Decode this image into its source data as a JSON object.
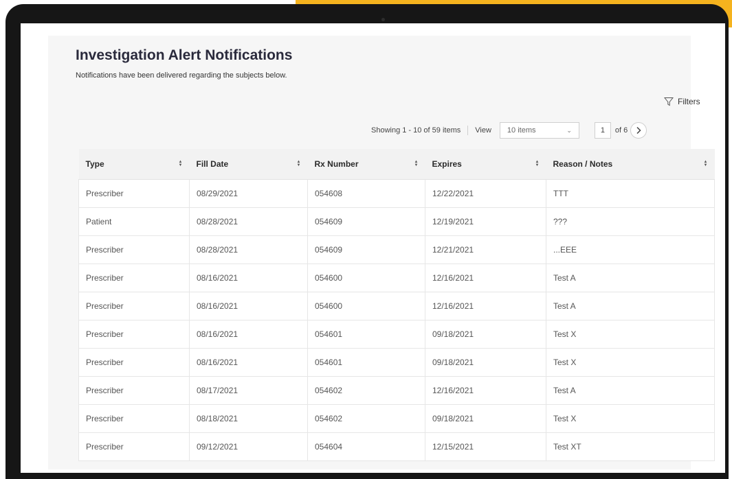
{
  "page": {
    "title": "Investigation Alert Notifications",
    "subtitle": "Notifications have been delivered regarding the subjects below."
  },
  "toolbar": {
    "filters_label": "Filters",
    "filter_icon": "funnel-icon"
  },
  "pagination": {
    "showing": "Showing 1 - 10 of 59 items",
    "view_label": "View",
    "page_size": "10 items",
    "current_page": "1",
    "of_total": "of 6"
  },
  "table": {
    "columns": [
      "Type",
      "Fill Date",
      "Rx Number",
      "Expires",
      "Reason / Notes"
    ],
    "rows": [
      [
        "Prescriber",
        "08/29/2021",
        "054608",
        "12/22/2021",
        "TTT"
      ],
      [
        "Patient",
        "08/28/2021",
        "054609",
        "12/19/2021",
        "???"
      ],
      [
        "Prescriber",
        "08/28/2021",
        "054609",
        "12/21/2021",
        "...EEE"
      ],
      [
        "Prescriber",
        "08/16/2021",
        "054600",
        "12/16/2021",
        "Test A"
      ],
      [
        "Prescriber",
        "08/16/2021",
        "054600",
        "12/16/2021",
        "Test A"
      ],
      [
        "Prescriber",
        "08/16/2021",
        "054601",
        "09/18/2021",
        "Test X"
      ],
      [
        "Prescriber",
        "08/16/2021",
        "054601",
        "09/18/2021",
        "Test X"
      ],
      [
        "Prescriber",
        "08/17/2021",
        "054602",
        "12/16/2021",
        "Test A"
      ],
      [
        "Prescriber",
        "08/18/2021",
        "054602",
        "09/18/2021",
        "Test X"
      ],
      [
        "Prescriber",
        "09/12/2021",
        "054604",
        "12/15/2021",
        "Test XT"
      ]
    ]
  },
  "colors": {
    "accent": "#f5b31e",
    "bezel": "#161616",
    "panel": "#f6f6f6"
  }
}
